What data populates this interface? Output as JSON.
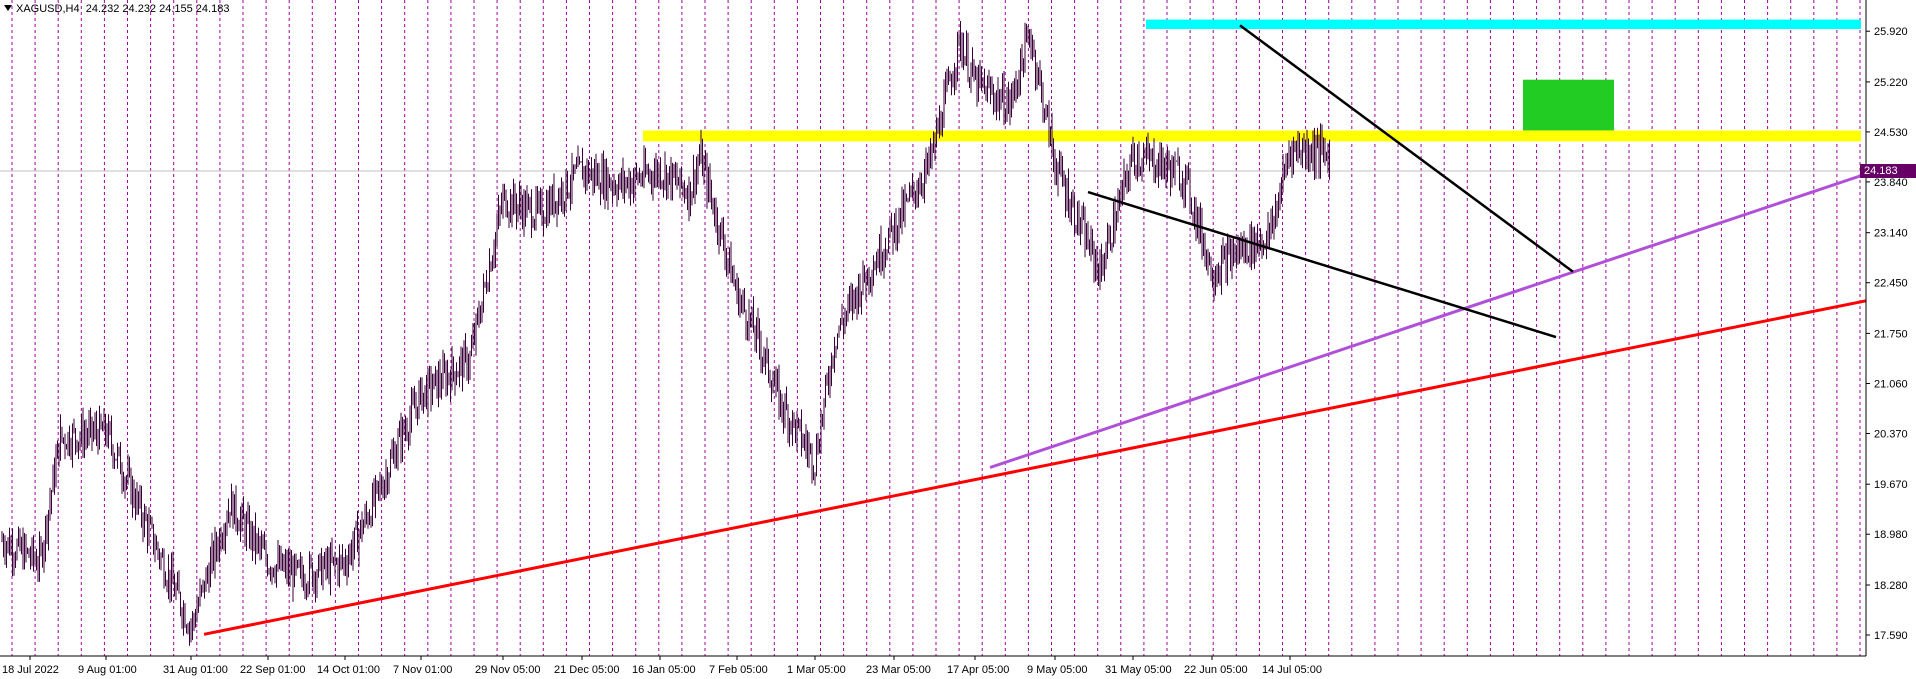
{
  "header": {
    "symbol": "XAGUSD,H4",
    "ohlc": "24.232 24.232 24.155 24.183"
  },
  "current_price_label": "24.183",
  "colors": {
    "candles": "#3a003a",
    "session_lines": "#a000a0",
    "support_line": "#ff0000",
    "trend_line": "#b050d8",
    "wedge_lines": "#000000",
    "top_zone": "#00ffff",
    "mid_zone": "#ffff00",
    "breakout_box": "#22cc22",
    "price_tag": "#660066"
  },
  "chart_data": {
    "type": "candlestick",
    "symbol": "XAGUSD",
    "timeframe": "H4",
    "ylim": [
      17.3,
      26.35
    ],
    "y_ticks": [
      "25.920",
      "25.220",
      "24.530",
      "23.840",
      "23.140",
      "22.450",
      "21.750",
      "21.060",
      "20.370",
      "19.670",
      "18.980",
      "18.280",
      "17.590"
    ],
    "x_ticks": [
      "18 Jul 2022",
      "9 Aug 01:00",
      "31 Aug 01:00",
      "22 Sep 01:00",
      "14 Oct 01:00",
      "7 Nov 01:00",
      "29 Nov 05:00",
      "21 Dec 05:00",
      "16 Jan 05:00",
      "7 Feb 05:00",
      "1 Mar 05:00",
      "23 Mar 05:00",
      "17 Apr 05:00",
      "9 May 05:00",
      "31 May 05:00",
      "22 Jun 05:00",
      "14 Jul 05:00"
    ],
    "close_path": [
      [
        "18 Jul 2022",
        18.8
      ],
      [
        "9 Aug 01:00",
        20.4
      ],
      [
        "31 Aug 01:00",
        17.7
      ],
      [
        "22 Sep 01:00",
        19.0
      ],
      [
        "14 Oct 01:00",
        18.5
      ],
      [
        "7 Nov 01:00",
        20.9
      ],
      [
        "29 Nov 05:00",
        23.6
      ],
      [
        "21 Dec 05:00",
        24.0
      ],
      [
        "16 Jan 05:00",
        24.0
      ],
      [
        "7 Feb 05:00",
        22.1
      ],
      [
        "1 Mar 05:00",
        20.1
      ],
      [
        "23 Mar 05:00",
        23.2
      ],
      [
        "17 Apr 05:00",
        25.2
      ],
      [
        "9 May 05:00",
        24.1
      ],
      [
        "31 May 05:00",
        24.2
      ],
      [
        "22 Jun 05:00",
        22.7
      ],
      [
        "14 Jul 05:00",
        24.2
      ]
    ],
    "last_price": 24.183,
    "price_line": 24.183,
    "zones": [
      {
        "name": "resistance-top",
        "from": 25.95,
        "to": 26.08
      },
      {
        "name": "resistance-mid",
        "from": 24.4,
        "to": 24.55
      },
      {
        "name": "breakout-box",
        "from": 24.55,
        "to": 25.25,
        "x_from": "5 Jul 2023",
        "x_to": "20 Jul 2023"
      }
    ],
    "lines": [
      {
        "name": "support",
        "from": [
          "31 Aug 2022",
          17.6
        ],
        "to": [
          "right-edge",
          22.2
        ]
      },
      {
        "name": "trend",
        "from": [
          "1 Mar 2023",
          19.9
        ],
        "to": [
          "right-edge",
          23.95
        ]
      },
      {
        "name": "wedge-upper",
        "from": [
          "19 Apr 2023",
          26.0
        ],
        "to": [
          "18 Jul 2023",
          22.6
        ]
      },
      {
        "name": "wedge-lower",
        "from": [
          "24 Mar 2023",
          23.7
        ],
        "to": [
          "18 Jul 2023",
          21.7
        ]
      }
    ],
    "grid": "vertical-dashed-sessions"
  }
}
